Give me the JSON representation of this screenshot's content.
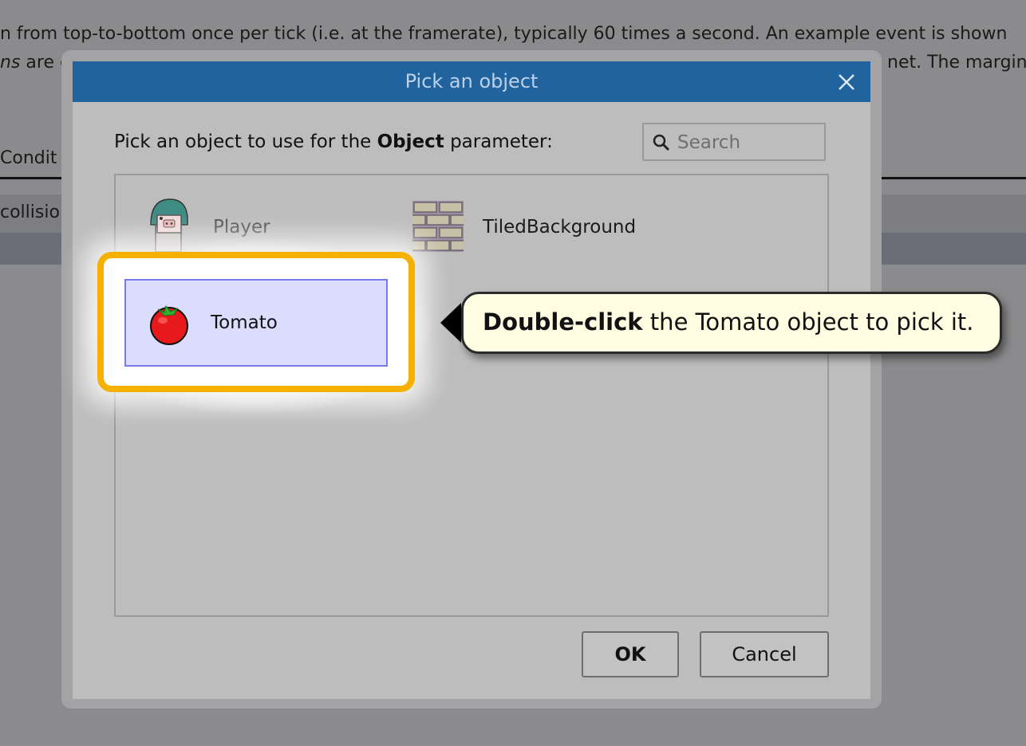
{
  "background": {
    "line1": "n from top-to-bottom once per tick (i.e. at the framerate), typically 60 times a second. An example event is shown",
    "line2_italic": "ns",
    "line2_rest": " are c",
    "line2_right": "net. The margin",
    "tab_label": "Condit",
    "cell_label": "collisio"
  },
  "dialog": {
    "title": "Pick an object",
    "prompt_prefix": "Pick an object to use for the ",
    "prompt_bold": "Object",
    "prompt_suffix": " parameter:",
    "search_placeholder": "Search",
    "items": [
      {
        "label": "Player",
        "icon": "player-sprite-icon"
      },
      {
        "label": "TiledBackground",
        "icon": "brick-tile-icon"
      },
      {
        "label": "Tomato",
        "icon": "tomato-icon",
        "selected": true
      }
    ],
    "ok_label": "OK",
    "cancel_label": "Cancel"
  },
  "tooltip": {
    "bold": "Double-click",
    "rest": " the Tomato object to pick it."
  },
  "colors": {
    "titlebar": "#21639e",
    "highlight_border": "#f5b000",
    "selected_fill": "#dcdcfe",
    "tooltip_fill": "#fffde2"
  }
}
